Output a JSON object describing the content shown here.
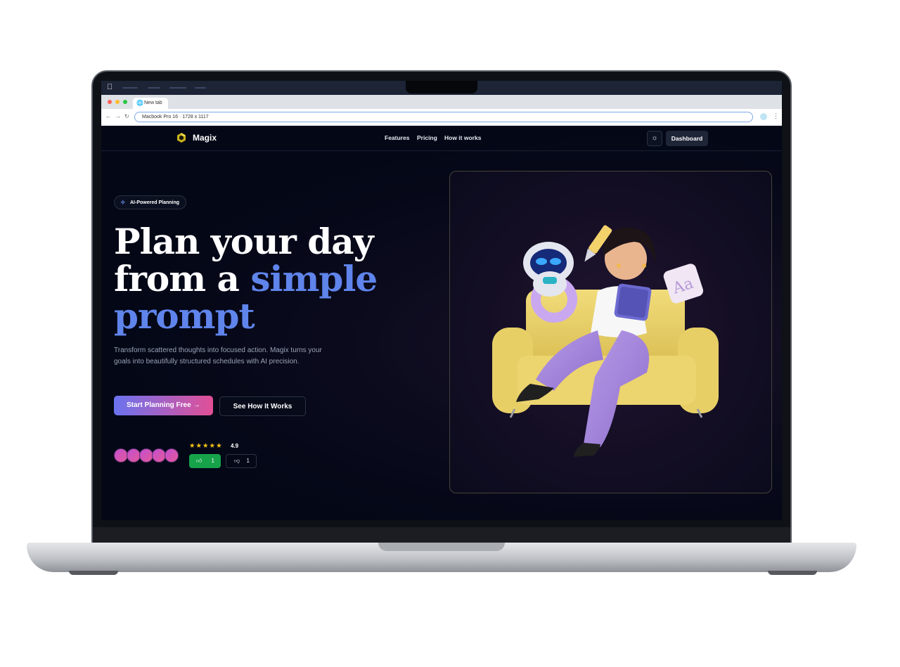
{
  "macos": {
    "menu_items": [
      "",
      "",
      "",
      ""
    ]
  },
  "browser": {
    "tab_title": "New tab",
    "url": "Macbook Pro 16 · 1728 x 1117",
    "traffic_colors": [
      "#ff5f57",
      "#febc2e",
      "#28c840"
    ]
  },
  "nav": {
    "brand": "Magix",
    "links": [
      "Features",
      "Pricing",
      "How it works"
    ],
    "dashboard_label": "Dashboard"
  },
  "hero": {
    "badge": "AI-Powered Planning",
    "headline_line1": "Plan your day",
    "headline_line2_a": "from a ",
    "headline_line2_b": "simple",
    "headline_line3": "prompt",
    "subtitle": "Transform scattered thoughts into focused action. Magix turns your goals into beautifully structured schedules with AI precision.",
    "cta_primary": "Start Planning Free →",
    "cta_secondary": "See How It Works",
    "rating": "4.9",
    "stars": "★★★★★",
    "likes": "1",
    "dislikes": "1",
    "avatar_count": 5
  },
  "colors": {
    "accent": "#5f84eb",
    "gradient_start": "#6a73ef",
    "gradient_end": "#e24f96",
    "like": "#16a34a"
  }
}
